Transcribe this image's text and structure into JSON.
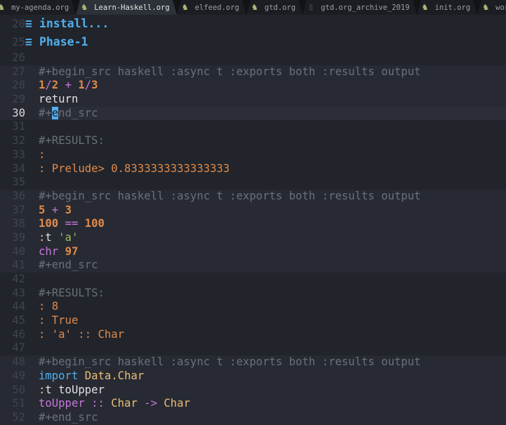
{
  "tabs": [
    {
      "label": "my-agenda.org",
      "icon": "org-unicorn-icon",
      "active": false
    },
    {
      "label": "Learn-Haskell.org",
      "icon": "org-unicorn-icon",
      "active": true
    },
    {
      "label": "elfeed.org",
      "icon": "org-unicorn-icon",
      "active": false
    },
    {
      "label": "gtd.org",
      "icon": "org-unicorn-icon",
      "active": false
    },
    {
      "label": "gtd.org_archive_2019",
      "icon": "file-icon",
      "active": false
    },
    {
      "label": "init.org",
      "icon": "org-unicorn-icon",
      "active": false
    },
    {
      "label": "wor",
      "icon": "org-unicorn-icon",
      "active": false
    }
  ],
  "colors": {
    "background": "#21242b",
    "accent": "#51afef",
    "number": "#e08a4a",
    "keyword": "#c678dd",
    "type": "#ecbe7b",
    "string": "#98be65",
    "comment": "#6a707a"
  },
  "lines": [
    {
      "n": "20",
      "kind": "head",
      "segs": [
        [
          "plain",
          "≡"
        ],
        [
          "head",
          "install..."
        ]
      ]
    },
    {
      "n": "25",
      "kind": "head",
      "segs": [
        [
          "plain",
          "≡"
        ],
        [
          "head",
          "Phase-1"
        ]
      ]
    },
    {
      "n": "26",
      "kind": "",
      "segs": []
    },
    {
      "n": "27",
      "kind": "block",
      "segs": [
        [
          "comment",
          "#+begin_src haskell :async t :exports both :results output"
        ]
      ]
    },
    {
      "n": "28",
      "kind": "block",
      "segs": [
        [
          "num",
          "1"
        ],
        [
          "op",
          "/"
        ],
        [
          "num",
          "2"
        ],
        [
          "plain",
          " "
        ],
        [
          "op",
          "+"
        ],
        [
          "plain",
          " "
        ],
        [
          "num",
          "1"
        ],
        [
          "op",
          "/"
        ],
        [
          "num",
          "3"
        ]
      ]
    },
    {
      "n": "29",
      "kind": "block",
      "segs": [
        [
          "plain",
          "return"
        ]
      ]
    },
    {
      "n": "30",
      "kind": "block current",
      "segs": [
        [
          "comment",
          "#+"
        ],
        [
          "cursor",
          "e"
        ],
        [
          "comment",
          "nd_src"
        ]
      ]
    },
    {
      "n": "31",
      "kind": "",
      "segs": []
    },
    {
      "n": "32",
      "kind": "",
      "segs": [
        [
          "comment",
          "#+RESULTS:"
        ]
      ]
    },
    {
      "n": "33",
      "kind": "",
      "segs": [
        [
          "res",
          ":"
        ]
      ]
    },
    {
      "n": "34",
      "kind": "",
      "segs": [
        [
          "res",
          ": Prelude> 0.8333333333333333"
        ]
      ]
    },
    {
      "n": "35",
      "kind": "",
      "segs": []
    },
    {
      "n": "36",
      "kind": "block",
      "segs": [
        [
          "comment",
          "#+begin_src haskell :async t :exports both :results output"
        ]
      ]
    },
    {
      "n": "37",
      "kind": "block",
      "segs": [
        [
          "num",
          "5"
        ],
        [
          "plain",
          " "
        ],
        [
          "op",
          "+"
        ],
        [
          "plain",
          " "
        ],
        [
          "num",
          "3"
        ]
      ]
    },
    {
      "n": "38",
      "kind": "block",
      "segs": [
        [
          "num",
          "100"
        ],
        [
          "plain",
          " "
        ],
        [
          "op",
          "=="
        ],
        [
          "plain",
          " "
        ],
        [
          "num",
          "100"
        ]
      ]
    },
    {
      "n": "39",
      "kind": "block",
      "segs": [
        [
          "colon",
          ":"
        ],
        [
          "plain",
          "t "
        ],
        [
          "str",
          "'a'"
        ]
      ]
    },
    {
      "n": "40",
      "kind": "block",
      "segs": [
        [
          "fn",
          "chr"
        ],
        [
          "plain",
          " "
        ],
        [
          "num",
          "97"
        ]
      ]
    },
    {
      "n": "41",
      "kind": "block",
      "segs": [
        [
          "comment",
          "#+end_src"
        ]
      ]
    },
    {
      "n": "42",
      "kind": "",
      "segs": []
    },
    {
      "n": "43",
      "kind": "",
      "segs": [
        [
          "comment",
          "#+RESULTS:"
        ]
      ]
    },
    {
      "n": "44",
      "kind": "",
      "segs": [
        [
          "res",
          ": 8"
        ]
      ]
    },
    {
      "n": "45",
      "kind": "",
      "segs": [
        [
          "res",
          ": True"
        ]
      ]
    },
    {
      "n": "46",
      "kind": "",
      "segs": [
        [
          "res",
          ": 'a' :: Char"
        ]
      ]
    },
    {
      "n": "47",
      "kind": "",
      "segs": []
    },
    {
      "n": "48",
      "kind": "block",
      "segs": [
        [
          "comment",
          "#+begin_src haskell :async t :exports both :results output"
        ]
      ]
    },
    {
      "n": "49",
      "kind": "block",
      "segs": [
        [
          "kw",
          "import"
        ],
        [
          "plain",
          " "
        ],
        [
          "type",
          "Data.Char"
        ]
      ]
    },
    {
      "n": "50",
      "kind": "block",
      "segs": [
        [
          "colon",
          ":"
        ],
        [
          "plain",
          "t toUpper"
        ]
      ]
    },
    {
      "n": "51",
      "kind": "block",
      "segs": [
        [
          "fn",
          "toUpper"
        ],
        [
          "plain",
          " "
        ],
        [
          "op",
          "::"
        ],
        [
          "plain",
          " "
        ],
        [
          "type",
          "Char"
        ],
        [
          "plain",
          " "
        ],
        [
          "op",
          "->"
        ],
        [
          "plain",
          " "
        ],
        [
          "type",
          "Char"
        ]
      ]
    },
    {
      "n": "52",
      "kind": "block",
      "segs": [
        [
          "comment",
          "#+end_src"
        ]
      ]
    }
  ]
}
